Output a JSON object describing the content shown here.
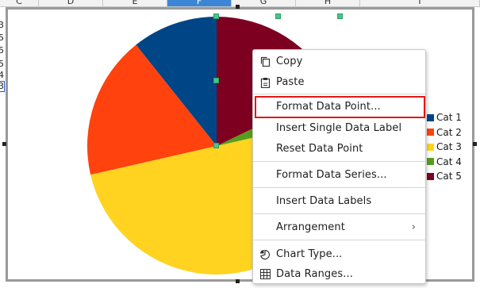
{
  "columns": [
    {
      "label": "C",
      "active": false
    },
    {
      "label": "D",
      "active": false
    },
    {
      "label": "E",
      "active": false
    },
    {
      "label": "F",
      "active": true
    },
    {
      "label": "G",
      "active": false
    },
    {
      "label": "H",
      "active": false
    },
    {
      "label": "I",
      "active": false
    }
  ],
  "row_values": [
    "3",
    "5",
    "5",
    "5",
    "4",
    "3"
  ],
  "chart_data": {
    "type": "pie",
    "categories": [
      "Cat 1",
      "Cat 2",
      "Cat 3",
      "Cat 4",
      "Cat 5"
    ],
    "values": [
      3,
      5,
      14,
      1,
      5
    ],
    "colors": [
      "#004586",
      "#ff420e",
      "#ffd320",
      "#579d1c",
      "#7e0021"
    ],
    "legend": "right"
  },
  "context_menu": {
    "items": [
      {
        "label": "Copy",
        "icon": "copy-icon"
      },
      {
        "label": "Paste",
        "icon": "paste-icon"
      },
      {
        "label": "Format Data Point...",
        "icon": ""
      },
      {
        "label": "Insert Single Data Label",
        "icon": ""
      },
      {
        "label": "Reset Data Point",
        "icon": ""
      },
      {
        "label": "Format Data Series...",
        "icon": ""
      },
      {
        "label": "Insert Data Labels",
        "icon": ""
      },
      {
        "label": "Arrangement",
        "icon": "chevron-right-icon"
      },
      {
        "label": "Chart Type...",
        "icon": "chart-type-icon"
      },
      {
        "label": "Data Ranges...",
        "icon": "data-ranges-icon"
      }
    ],
    "highlighted": "Format Data Point..."
  }
}
